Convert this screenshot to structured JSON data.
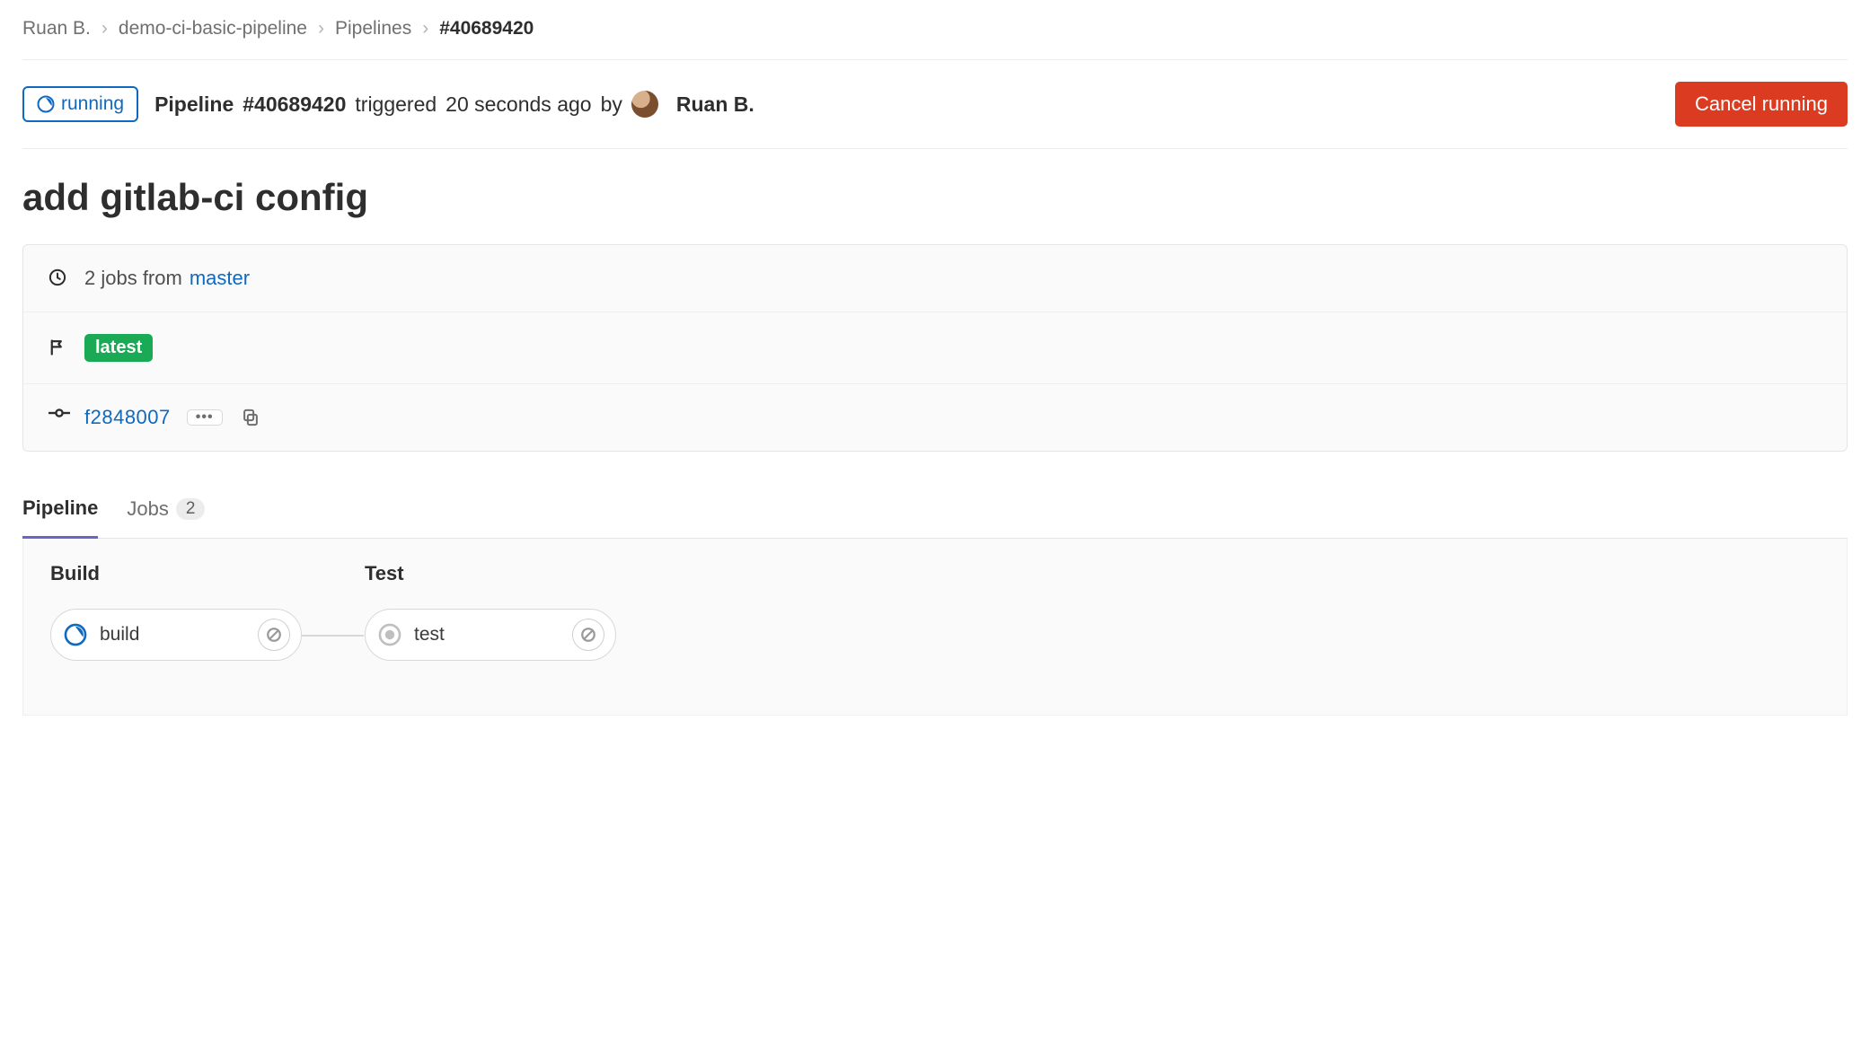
{
  "breadcrumb": {
    "owner": "Ruan B.",
    "project": "demo-ci-basic-pipeline",
    "section": "Pipelines",
    "current": "#40689420"
  },
  "status": {
    "label": "running"
  },
  "triggered": {
    "prefix": "Pipeline",
    "pipeline_id": "#40689420",
    "triggered_word": "triggered",
    "time_ago": "20 seconds ago",
    "by_word": "by",
    "user_name": "Ruan B."
  },
  "actions": {
    "cancel_label": "Cancel running"
  },
  "title": "add gitlab-ci config",
  "jobs_summary": {
    "count_text": "2 jobs from",
    "branch": "master"
  },
  "tags": {
    "latest_label": "latest"
  },
  "commit": {
    "sha": "f2848007"
  },
  "tabs": {
    "pipeline_label": "Pipeline",
    "jobs_label": "Jobs",
    "jobs_count": "2"
  },
  "graph": {
    "stages": [
      {
        "name": "Build",
        "jobs": [
          {
            "name": "build",
            "status": "running"
          }
        ]
      },
      {
        "name": "Test",
        "jobs": [
          {
            "name": "test",
            "status": "pending"
          }
        ]
      }
    ]
  }
}
